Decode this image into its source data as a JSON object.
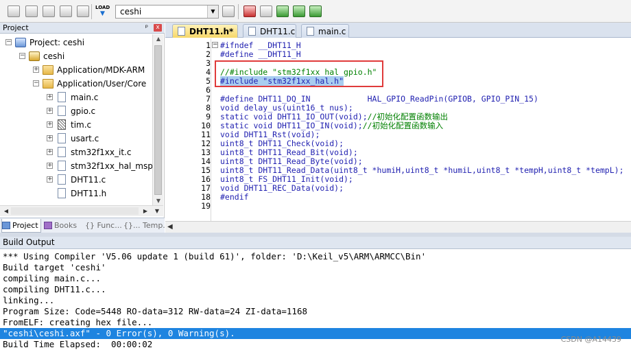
{
  "toolbar": {
    "load_label": "LOAD",
    "target_value": "ceshi"
  },
  "project_panel": {
    "title": "Project",
    "pin": "ᵖ",
    "close": "x",
    "tree": [
      {
        "label": "Project: ceshi",
        "icon": "project-icon"
      },
      {
        "label": "ceshi",
        "icon": "target-icon"
      },
      {
        "label": "Application/MDK-ARM",
        "icon": "folder-icon"
      },
      {
        "label": "Application/User/Core",
        "icon": "folder-icon"
      },
      {
        "label": "main.c",
        "icon": "file-icon"
      },
      {
        "label": "gpio.c",
        "icon": "file-icon"
      },
      {
        "label": "tim.c",
        "icon": "file-icon"
      },
      {
        "label": "usart.c",
        "icon": "file-icon"
      },
      {
        "label": "stm32f1xx_it.c",
        "icon": "file-icon"
      },
      {
        "label": "stm32f1xx_hal_msp.c",
        "icon": "file-icon"
      },
      {
        "label": "DHT11.c",
        "icon": "file-icon"
      },
      {
        "label": "DHT11.h",
        "icon": "file-icon"
      }
    ],
    "tabs": [
      "Project",
      "Books",
      "{} Func...",
      "{}... Temp..."
    ]
  },
  "editor": {
    "tabs": [
      {
        "label": "DHT11.h*",
        "active": true
      },
      {
        "label": "DHT11.c",
        "active": false
      },
      {
        "label": "main.c",
        "active": false
      }
    ],
    "lines": [
      {
        "n": "1",
        "text": "#ifndef __DHT11_H"
      },
      {
        "n": "2",
        "text": "#define __DHT11_H"
      },
      {
        "n": "3",
        "text": ""
      },
      {
        "n": "4",
        "text": "//#include \"stm32f1xx_hal_gpio.h\""
      },
      {
        "n": "5",
        "text": "#include \"stm32f1xx_hal.h\""
      },
      {
        "n": "6",
        "text": ""
      },
      {
        "n": "7",
        "text": "#define DHT11_DQ_IN            HAL_GPIO_ReadPin(GPIOB, GPIO_PIN_15)"
      },
      {
        "n": "8",
        "text": "void delay_us(uint16_t nus);"
      },
      {
        "n": "9",
        "text": "static void DHT11_IO_OUT(void);//初始化配置函数输出"
      },
      {
        "n": "10",
        "text": "static void DHT11_IO_IN(void);//初始化配置函数输入"
      },
      {
        "n": "11",
        "text": "void DHT11_Rst(void);"
      },
      {
        "n": "12",
        "text": "uint8_t DHT11_Check(void);"
      },
      {
        "n": "13",
        "text": "uint8_t DHT11_Read_Bit(void);"
      },
      {
        "n": "14",
        "text": "uint8_t DHT11_Read_Byte(void);"
      },
      {
        "n": "15",
        "text": "uint8_t DHT11_Read_Data(uint8_t *humiH,uint8_t *humiL,uint8_t *tempH,uint8_t *tempL);"
      },
      {
        "n": "16",
        "text": "uint8_t FS_DHT11_Init(void);"
      },
      {
        "n": "17",
        "text": "void DHT11_REC_Data(void);"
      },
      {
        "n": "18",
        "text": "#endif"
      },
      {
        "n": "19",
        "text": ""
      }
    ]
  },
  "build_output": {
    "title": "Build Output",
    "lines": [
      "*** Using Compiler 'V5.06 update 1 (build 61)', folder: 'D:\\Keil_v5\\ARM\\ARMCC\\Bin'",
      "Build target 'ceshi'",
      "compiling main.c...",
      "compiling DHT11.c...",
      "linking...",
      "Program Size: Code=5448 RO-data=312 RW-data=24 ZI-data=1168",
      "FromELF: creating hex file...",
      "\"ceshi\\ceshi.axf\" - 0 Error(s), 0 Warning(s).",
      "Build Time Elapsed:  00:00:02"
    ],
    "selected_index": 7
  },
  "watermark": "CSDN @A14439",
  "colors": {
    "keyword": "#1f1fb0",
    "comment": "#008000",
    "selection": "#1e84e0",
    "highlight_box": "#e03a3a"
  }
}
